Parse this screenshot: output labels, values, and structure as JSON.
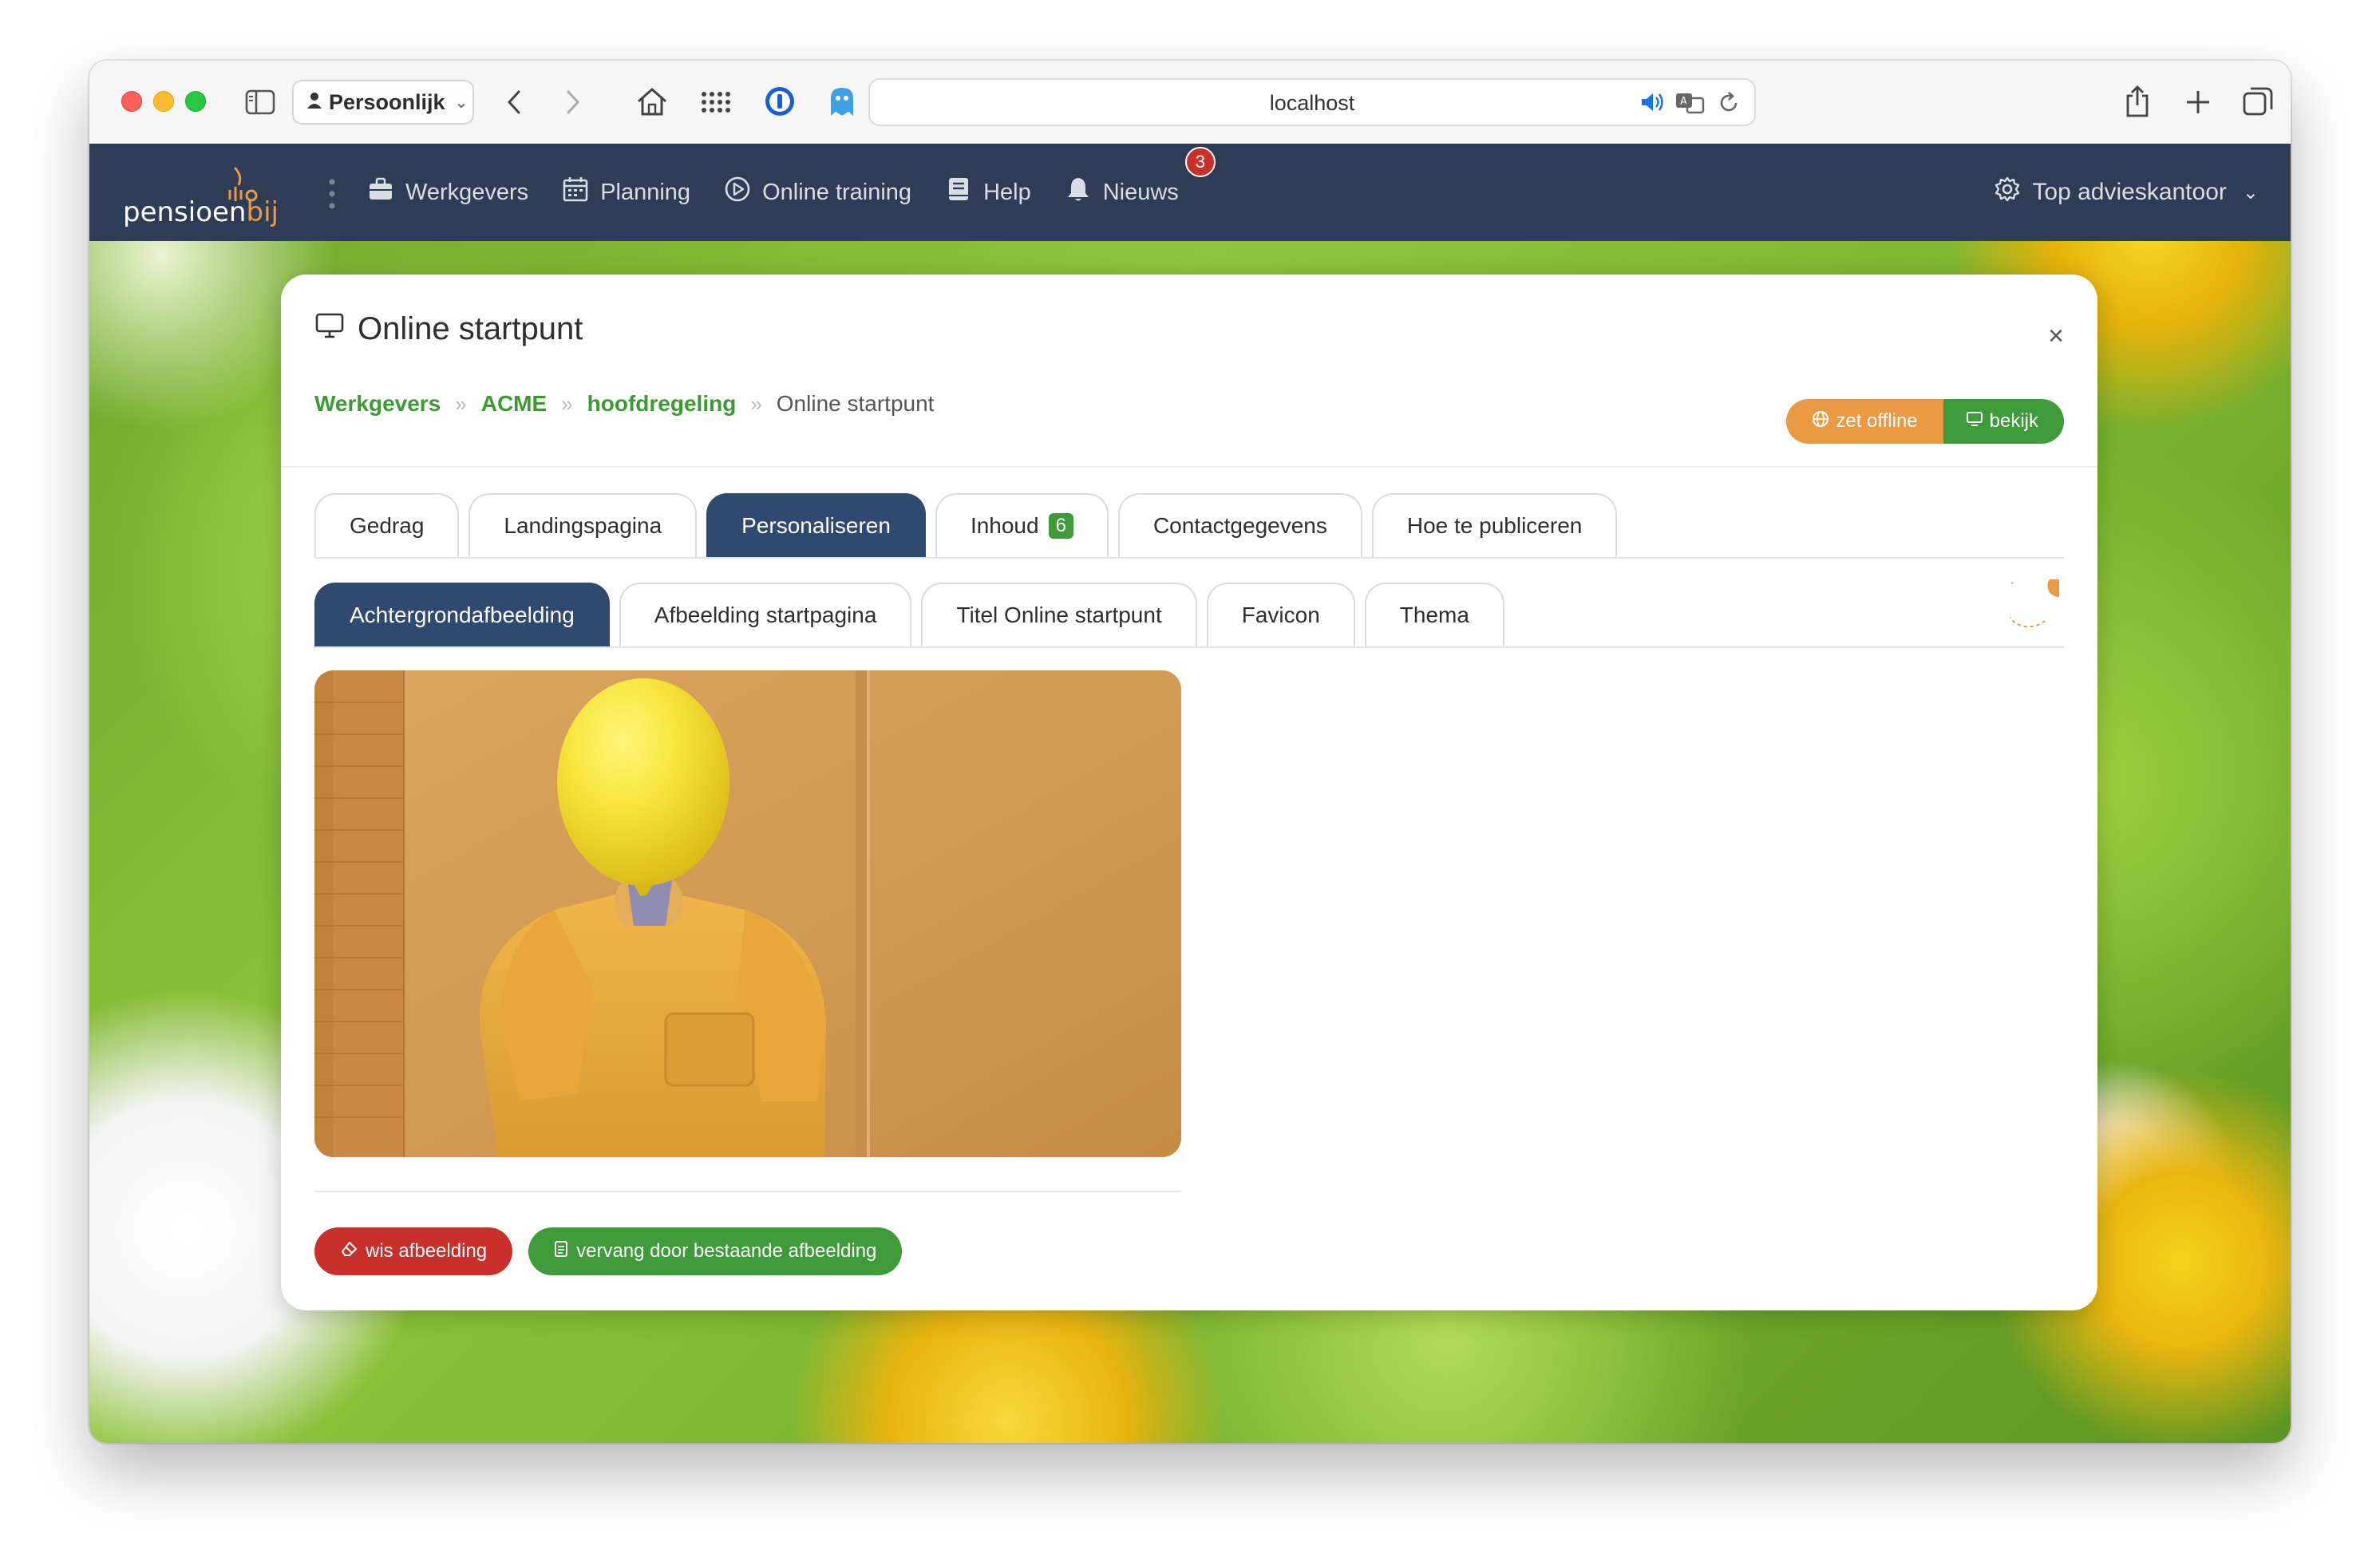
{
  "browser": {
    "profile_label": "Persoonlijk",
    "url": "localhost"
  },
  "nav": {
    "logo_text_1": "pensioen",
    "logo_text_2": "bij",
    "items": [
      {
        "label": "Werkgevers",
        "icon": "briefcase-icon"
      },
      {
        "label": "Planning",
        "icon": "calendar-icon"
      },
      {
        "label": "Online training",
        "icon": "play-circle-icon"
      },
      {
        "label": "Help",
        "icon": "book-icon"
      },
      {
        "label": "Nieuws",
        "icon": "bell-icon",
        "badge": "3"
      }
    ],
    "org_label": "Top advieskantoor"
  },
  "card": {
    "title": "Online startpunt",
    "close": "×",
    "breadcrumb": [
      "Werkgevers",
      "ACME",
      "hoofdregeling",
      "Online startpunt"
    ],
    "btn_offline": "zet offline",
    "btn_view": "bekijk",
    "tabs": [
      {
        "label": "Gedrag"
      },
      {
        "label": "Landingspagina"
      },
      {
        "label": "Personaliseren",
        "active": true
      },
      {
        "label": "Inhoud",
        "count": "6"
      },
      {
        "label": "Contactgegevens"
      },
      {
        "label": "Hoe te publiceren"
      }
    ],
    "subtabs": [
      {
        "label": "Achtergrondafbeelding",
        "active": true
      },
      {
        "label": "Afbeelding startpagina"
      },
      {
        "label": "Titel Online startpunt"
      },
      {
        "label": "Favicon"
      },
      {
        "label": "Thema"
      }
    ],
    "btn_clear": "wis afbeelding",
    "btn_replace": "vervang door bestaande afbeelding"
  },
  "colors": {
    "navbar": "#2f3c55",
    "active_tab": "#2f4a6e",
    "link_green": "#3a9b32",
    "btn_orange": "#e99a43",
    "btn_green": "#3f9b3a",
    "btn_red": "#c9302c"
  }
}
